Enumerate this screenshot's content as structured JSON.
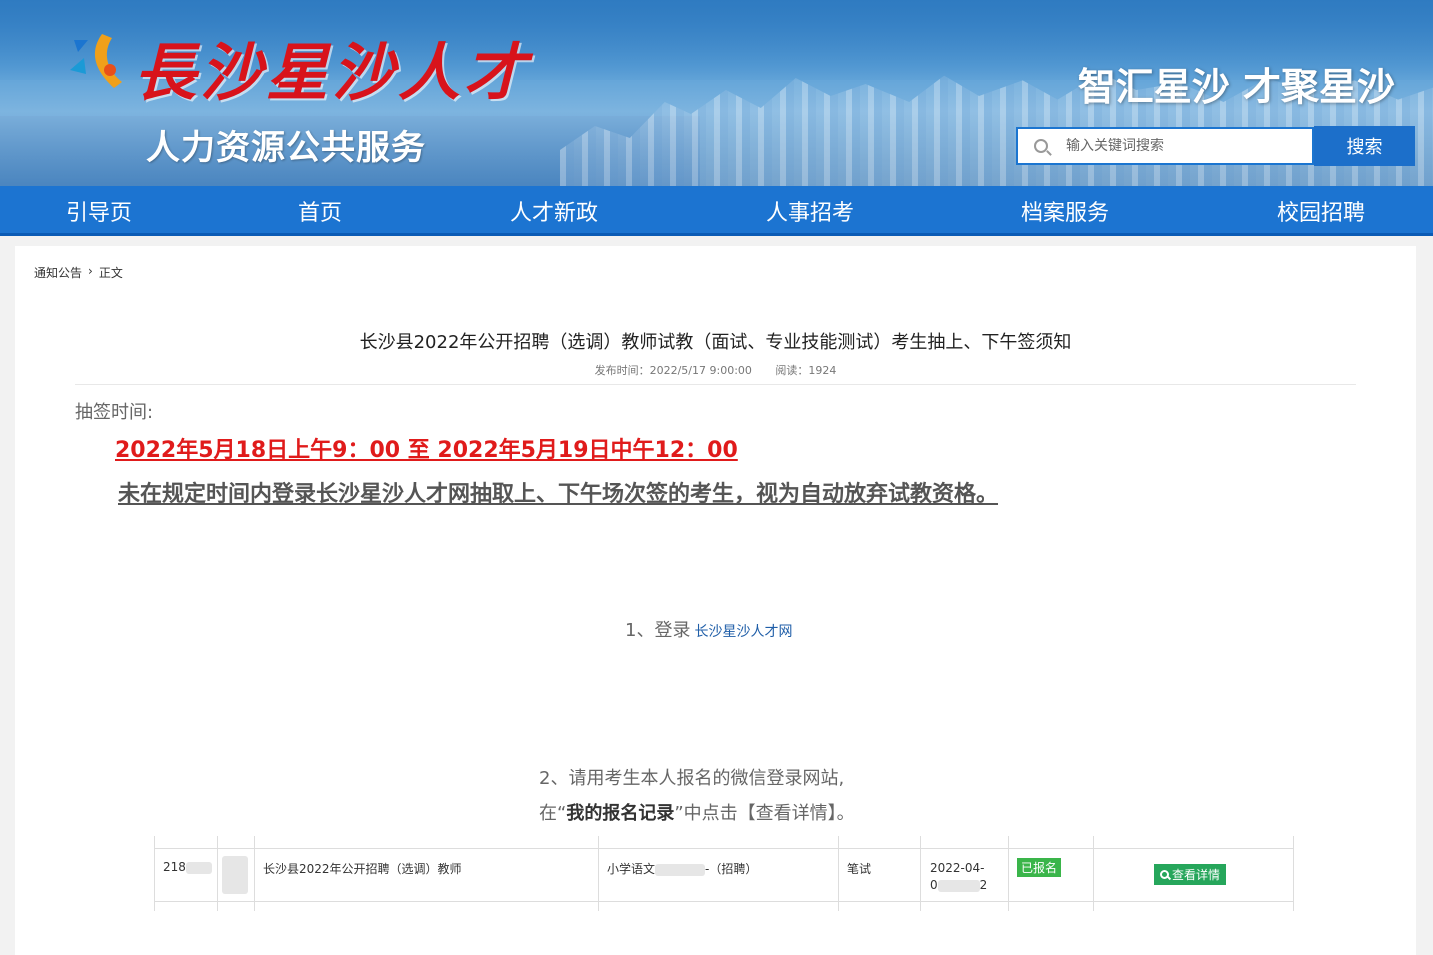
{
  "header": {
    "site_name": "長沙星沙人才",
    "subtitle": "人力资源公共服务",
    "slogan": "智汇星沙 才聚星沙",
    "search_placeholder": "输入关键词搜索",
    "search_button": "搜索"
  },
  "nav": [
    "引导页",
    "首页",
    "人才新政",
    "人事招考",
    "档案服务",
    "校园招聘"
  ],
  "breadcrumb": [
    "通知公告",
    "正文"
  ],
  "article": {
    "title": "长沙县2022年公开招聘（选调）教师试教（面试、专业技能测试）考生抽上、下午签须知",
    "publish_time": "发布时间：2022/5/17 9:00:00",
    "reads": "阅读：1924",
    "time_label": "抽签时间:",
    "time_range": "2022年5月18日上午9：00 至 2022年5月19日中午12：00",
    "warning": "未在规定时间内登录长沙星沙人才网抽取上、下午场次签的考生，视为自动放弃试教资格。",
    "step1_text": "1、登录",
    "step1_link": "长沙星沙人才网",
    "step2_line1": "2、请用考生本人报名的微信登录网站,",
    "step2_prefix": "在“",
    "step2_bold": "我的报名记录",
    "step2_suffix": "”中点击【查看详情】。"
  },
  "table_row": {
    "id": "218",
    "project": "长沙县2022年公开招聘（选调）教师",
    "position_prefix": "小学语文",
    "position_suffix": "-（招聘）",
    "stage": "笔试",
    "date_top": "2022-04-",
    "date_bottom_start": "0",
    "date_bottom_end": "2",
    "status": "已报名",
    "detail": "查看详情"
  },
  "colors": {
    "nav_bg": "#1c74d1",
    "site_name": "#d8131b",
    "time_range": "#e01b1b",
    "badge": "#3ab54a"
  }
}
